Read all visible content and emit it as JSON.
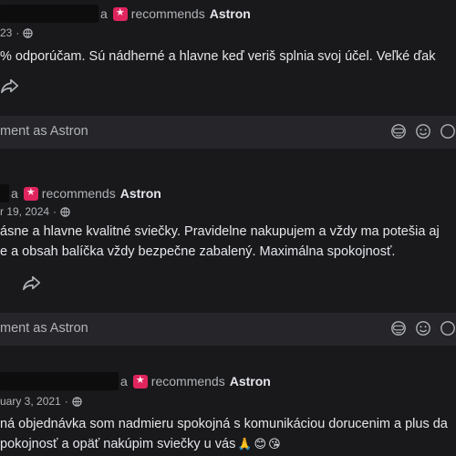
{
  "reviews": [
    {
      "name_tail": "a",
      "recommends_word": "recommends",
      "page_name": "Astron",
      "date": "23",
      "text": [
        "% odporúčam. Sú  nádherné a hlavne keď veriš splnia svoj účel. Veľké ďak"
      ],
      "comment_placeholder": "ment as Astron"
    },
    {
      "name_tail": "a",
      "recommends_word": "recommends",
      "page_name": "Astron",
      "date": "r 19, 2024",
      "text": [
        "ásne a hlavne kvalitné sviečky. Pravidelne nakupujem a vždy ma potešia aj",
        "e a obsah balíčka vždy bezpečne zabalený. Maximálna spokojnosť."
      ],
      "comment_placeholder": "ment as Astron"
    },
    {
      "name_tail": "a",
      "recommends_word": "recommends",
      "page_name": "Astron",
      "date": "uary 3, 2021",
      "text": [
        "ná objednávka som nadmieru spokojná s komunikáciou dorucenim a plus da",
        "pokojnosť a opäť nakúpim sviečky u vás"
      ],
      "emojis": [
        "🙏",
        "😊",
        "😘"
      ]
    }
  ],
  "icons": {
    "globe": "globe-icon",
    "share": "share-icon",
    "gif": "gif-icon",
    "emoji": "emoji-icon",
    "recommend": "recommend-badge-icon"
  },
  "colors": {
    "background": "#19191b",
    "comment_bar": "#26262a",
    "text_primary": "#e4e6eb",
    "text_secondary": "#b0b3b8",
    "recommend_badge": "#e0245e"
  }
}
